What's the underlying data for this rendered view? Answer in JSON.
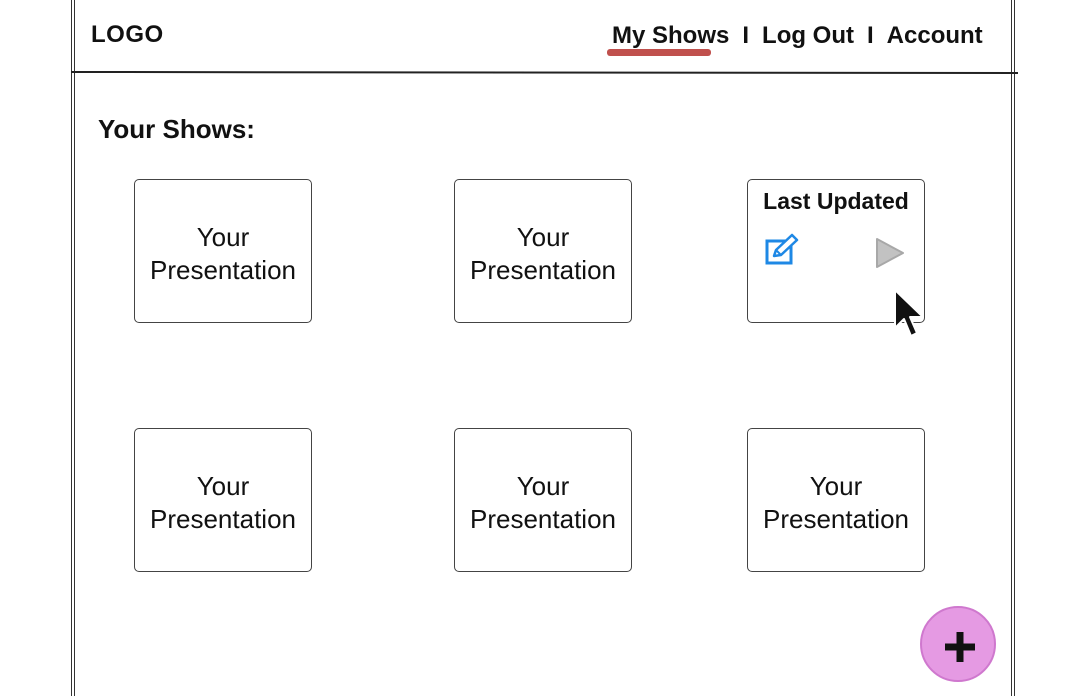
{
  "header": {
    "logo": "LOGO",
    "nav": {
      "my_shows": "My Shows",
      "separator": "I",
      "log_out": "Log Out",
      "account": "Account"
    },
    "active_item": "My Shows"
  },
  "main": {
    "title": "Your Shows:",
    "cards": [
      {
        "label": "Your\nPresentation"
      },
      {
        "label": "Your\nPresentation"
      },
      {
        "hover_title": "Last Updated",
        "actions": [
          "edit-icon",
          "play-icon"
        ]
      },
      {
        "label": "Your\nPresentation"
      },
      {
        "label": "Your\nPresentation"
      },
      {
        "label": "Your\nPresentation"
      }
    ]
  },
  "colors": {
    "active_underline": "#c0504d",
    "edit_icon": "#1e88e5",
    "play_icon": "#c2c2c2",
    "fab_fill": "#e59ae3",
    "fab_border": "#cf78ce"
  },
  "fab": {
    "icon": "plus-icon"
  }
}
